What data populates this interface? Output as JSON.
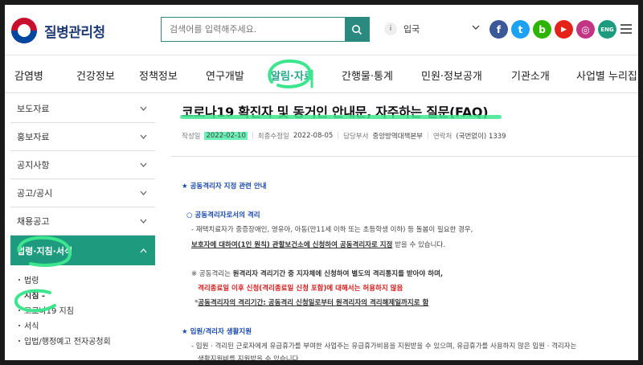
{
  "header": {
    "site_name": "질병관리청",
    "search_placeholder": "검색어를 입력해주세요.",
    "lang_badge": "i",
    "lang_label": "입국",
    "social": [
      {
        "name": "facebook",
        "glyph": "f",
        "color": "#3b5998"
      },
      {
        "name": "twitter",
        "glyph": "t",
        "color": "#1da1f2"
      },
      {
        "name": "blog",
        "glyph": "b",
        "color": "#2db400"
      },
      {
        "name": "youtube",
        "glyph": "▶",
        "color": "#e62117"
      },
      {
        "name": "instagram",
        "glyph": "◎",
        "color": "#c13584"
      },
      {
        "name": "english",
        "glyph": "ENG",
        "color": "#1e9b7e"
      }
    ]
  },
  "nav": {
    "items": [
      {
        "label": "감염병"
      },
      {
        "label": "건강정보"
      },
      {
        "label": "정책정보"
      },
      {
        "label": "연구개발"
      },
      {
        "label": "알림·자료"
      },
      {
        "label": "간행물·통계"
      },
      {
        "label": "민원·정보공개"
      },
      {
        "label": "기관소개"
      },
      {
        "label": "사업별 누리집"
      }
    ],
    "active_index": 4
  },
  "sidebar": {
    "items": [
      {
        "label": "보도자료"
      },
      {
        "label": "홍보자료"
      },
      {
        "label": "공지사항"
      },
      {
        "label": "공고/공시"
      },
      {
        "label": "채용공고"
      },
      {
        "label": "법령·지침·서식"
      }
    ],
    "sub_items": [
      {
        "label": "법령"
      },
      {
        "label": "지침 -"
      },
      {
        "label": "코로나19 지침"
      },
      {
        "label": "서식"
      },
      {
        "label": "입법/행정예고 전자공청회"
      }
    ]
  },
  "article": {
    "title": "코로나19 확진자 및 동거인 안내문, 자주하는 질문(FAQ)",
    "meta": {
      "created_label": "작성일",
      "created_value": "2022-02-10",
      "updated_label": "최종수정일",
      "updated_value": "2022-08-05",
      "dept_label": "담당부서",
      "dept_value": "중앙방역대책본부",
      "contact_label": "연락처",
      "contact_value": "(국번없이) 1339"
    },
    "lines": {
      "section1": "★ 공동격리자 지정 관련 안내",
      "sub1": "○ 공동격리자로서의 격리",
      "l1": "- 재택치료자가 중증장애인, 영유아, 아동(만11세 이하 또는 초등학생 이하) 등 돌봄이 필요한 경우,",
      "l2_u": "보호자에 대하여(1인 원칙) 관할보건소에 신청하여 공동격리자로 지정",
      "l2_rest": "받을 수 있습니다.",
      "n1_prefix": "※ 공동격리는 ",
      "n1_bold": "원격리자 격리기간 중 지자체에 신청하여 별도의 격리통지를 받아야 하며,",
      "n2_red": "격리종료일 이후 신청(격리종료일 신청 포함)에 대해서는 허용하지 않음",
      "n3_star": "*",
      "n3_u": "공동격리자의 격리기간: 공동격리 신청일로부터 원격리자의 격리해제일까지로 함",
      "section2": "★ 입원/격리자 생활지원",
      "l4": "- 입원 · 격리된 근로자에게 유급휴가를 부여한 사업주는 유급휴가비용을 지원받을 수 있으며, 유급휴가를 사용하지 않은 입원 · 격리자는",
      "l5": "생활지원비를 지원받을 수 있습니다."
    }
  }
}
